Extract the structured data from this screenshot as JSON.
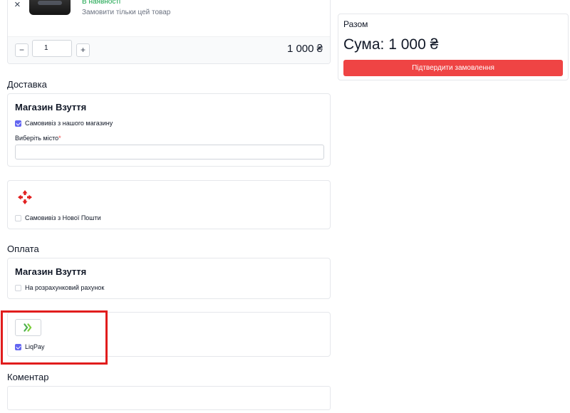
{
  "cart_item": {
    "remove_glyph": "×",
    "stock_status": "В наявності",
    "order_only_this": "Замовити тільки цей товар",
    "qty_minus": "−",
    "qty_plus": "+",
    "quantity": "1",
    "price": "1 000 ₴"
  },
  "delivery": {
    "title": "Доставка",
    "store_option": {
      "store_name": "Магазин Взуття",
      "checkbox_label": "Самовивіз з нашого магазину",
      "checked": true,
      "city_label": "Виберіть місто",
      "required_mark": "*",
      "city_value": ""
    },
    "nova_poshta_option": {
      "icon": "nova-poshta-logo-icon",
      "checkbox_label": "Самовивіз з Нової Пошти",
      "checked": false
    }
  },
  "payment": {
    "title": "Оплата",
    "account_option": {
      "store_name": "Магазин Взуття",
      "checkbox_label": "На розрахунковий рахунок",
      "checked": false
    },
    "liqpay_option": {
      "icon": "liqpay-logo-icon",
      "checkbox_label": "LiqPay",
      "checked": true
    }
  },
  "comment": {
    "title": "Коментар",
    "value": ""
  },
  "summary": {
    "title": "Разом",
    "total": "Сума: 1 000 ₴",
    "confirm_label": "Підтвердити замовлення"
  },
  "colors": {
    "accent_checkbox": "#6366f1",
    "confirm_button": "#ef4444",
    "in_stock": "#16a34a",
    "highlight": "#e11d1d"
  }
}
